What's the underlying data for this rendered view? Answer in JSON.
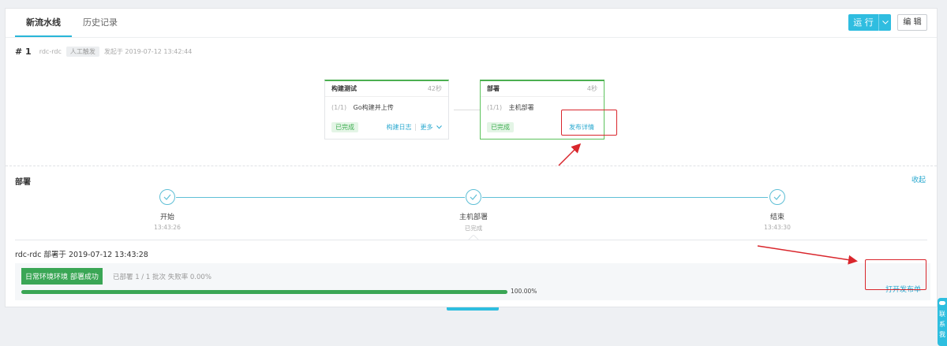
{
  "tabs": [
    {
      "label": "新流水线",
      "active": true
    },
    {
      "label": "历史记录",
      "active": false
    }
  ],
  "toolbar": {
    "run_label": "运 行",
    "edit_label": "编 辑"
  },
  "run": {
    "number": "# 1",
    "repo": "rdc-rdc",
    "trigger": "人工触发",
    "started": "发起于 2019-07-12 13:42:44"
  },
  "stages": [
    {
      "name": "构建测试",
      "duration": "42秒",
      "task_index": "(1/1)",
      "task_name": "Go构建并上传",
      "status": "已完成",
      "link1": "构建日志",
      "link2": "更多"
    },
    {
      "name": "部署",
      "duration": "4秒",
      "task_index": "(1/1)",
      "task_name": "主机部署",
      "status": "已完成",
      "link1": "发布详情"
    }
  ],
  "deploy": {
    "title": "部署",
    "collapse_label": "收起",
    "steps": [
      {
        "label": "开始",
        "sub": "13:43:26"
      },
      {
        "label": "主机部署",
        "sub": "已完成"
      },
      {
        "label": "结束",
        "sub": "13:43:30"
      }
    ],
    "head": "rdc-rdc 部署于 2019-07-12 13:43:28",
    "success_tag": "日常环境环境 部署成功",
    "stat": "已部署 1 / 1 批次  失败率 0.00%",
    "progress_pct": 100,
    "progress_text": "100.00%",
    "open_release": "打开发布单"
  },
  "side_widget": {
    "text": "联系我"
  },
  "colors": {
    "accent": "#2fbde0",
    "success": "#3aa655",
    "annotation": "#d9262c"
  }
}
